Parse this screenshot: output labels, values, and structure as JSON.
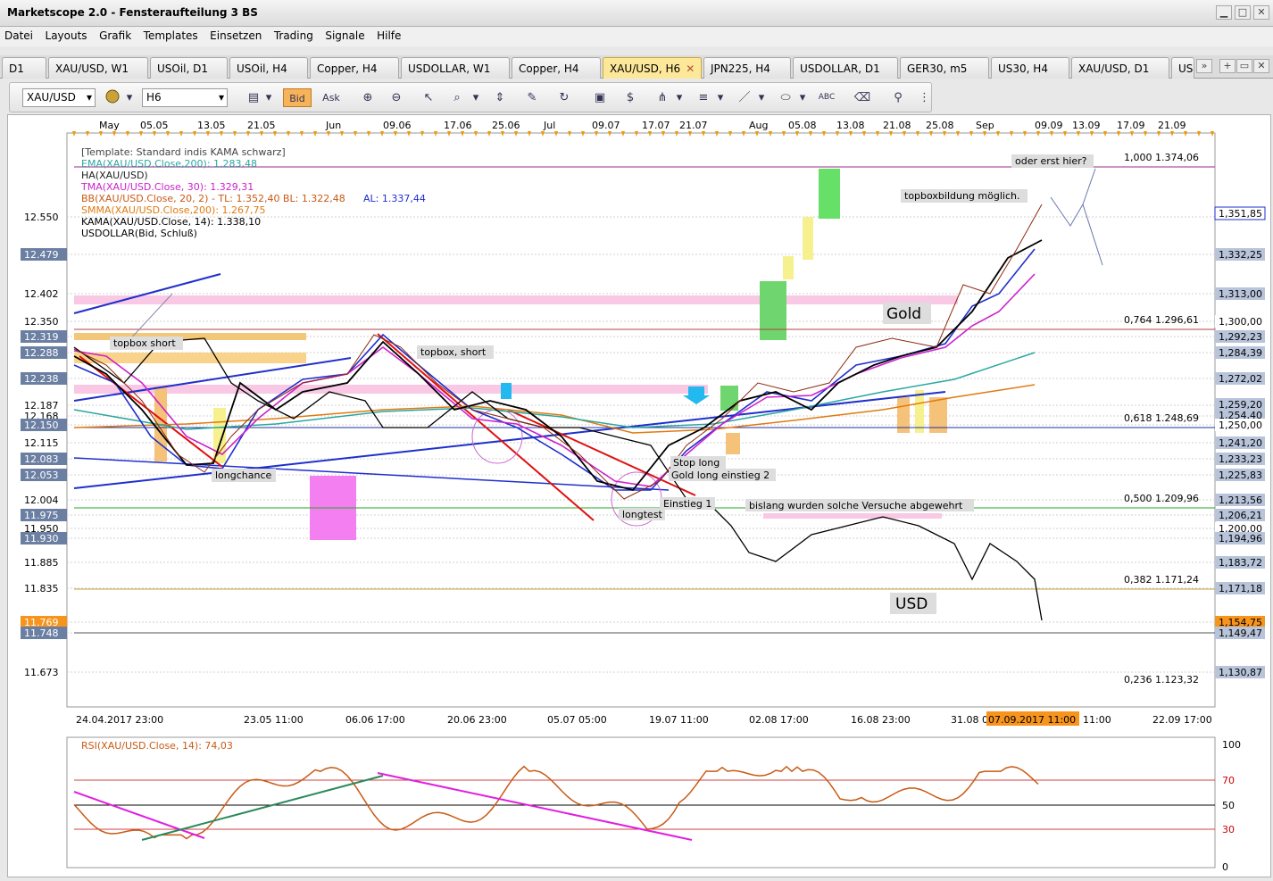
{
  "app": {
    "title": "Marketscope 2.0 - Fensteraufteilung 3 BS"
  },
  "menu": [
    "Datei",
    "Layouts",
    "Grafik",
    "Templates",
    "Einsetzen",
    "Trading",
    "Signale",
    "Hilfe"
  ],
  "tabs": [
    "D1",
    "XAU/USD, W1",
    "USOil, D1",
    "USOil, H4",
    "Copper, H4",
    "USDOLLAR, W1",
    "Copper, H4",
    "XAU/USD, H6",
    "JPN225, H4",
    "USDOLLAR, D1",
    "GER30, m5",
    "US30, H4",
    "XAU/USD, D1",
    "US"
  ],
  "active_tab_index": 7,
  "toolbar": {
    "symbol": "XAU/USD",
    "timeframe": "H6",
    "bid_label": "Bid",
    "ask_label": "Ask"
  },
  "time_axis_top": [
    "May",
    "05.05",
    "13.05",
    "21.05",
    "Jun",
    "09.06",
    "17.06",
    "25.06",
    "Jul",
    "09.07",
    "17.07",
    "21.07",
    "Aug",
    "05.08",
    "13.08",
    "21.08",
    "25.08",
    "Sep",
    "09.09",
    "13.09",
    "17.09",
    "21.09"
  ],
  "time_axis_bottom": [
    "24.04.2017 23:00",
    "23.05 11:00",
    "06.06 17:00",
    "20.06 23:00",
    "05.07 05:00",
    "19.07 11:00",
    "02.08 17:00",
    "16.08 23:00",
    "31.08 0",
    "07.09.2017 11:00",
    "11:00",
    "22.09 17:00"
  ],
  "left_axis": [
    "12.550",
    "12.479",
    "12.402",
    "12.350",
    "12.319",
    "12.288",
    "12.238",
    "12.187",
    "12.168",
    "12.150",
    "12.115",
    "12.083",
    "12.053",
    "12.004",
    "11.975",
    "11.950",
    "11.930",
    "11.885",
    "11.835",
    "11.769",
    "11.748",
    "11.673"
  ],
  "right_axis": [
    "1,351,85",
    "1,332,25",
    "1,313,00",
    "1,300,00",
    "1,292,23",
    "1,284,39",
    "1,272,02",
    "1,259,20",
    "1,254,40",
    "1,250,00",
    "1,241,20",
    "1,233,23",
    "1,225,83",
    "1,213,56",
    "1,206,21",
    "1,200,00",
    "1,194,96",
    "1,183,72",
    "1,171,18",
    "1,154,75",
    "1,149,47",
    "1,130,87"
  ],
  "fib_levels": [
    "1,000 1.374,06",
    "0,764 1.296,61",
    "0,618 1.248,69",
    "0,500 1.209,96",
    "0,382 1.171,24",
    "0,236 1.123,32"
  ],
  "legend": [
    {
      "text": "[Template: Standard indis KAMA schwarz]",
      "color": "#444444"
    },
    {
      "text": "EMA(XAU/USD.Close,200): 1.283,48",
      "color": "#2aa7a0"
    },
    {
      "text": "HA(XAU/USD)",
      "color": "#222222"
    },
    {
      "text": "TMA(XAU/USD.Close, 30): 1.329,31",
      "color": "#cc22cc"
    },
    {
      "text": "BB(XAU/USD.Close, 20, 2) -  TL: 1.352,40   BL: 1.322,48",
      "color": "#c85a14"
    },
    {
      "text": "AL: 1.337,44",
      "color": "#1f2fcc"
    },
    {
      "text": "SMMA(XAU/USD.Close,200): 1.267,75",
      "color": "#e07a10"
    },
    {
      "text": "KAMA(XAU/USD.Close, 14): 1.338,10",
      "color": "#000000"
    },
    {
      "text": "USDOLLAR(Bid, Schluß)",
      "color": "#000000"
    }
  ],
  "annotations": {
    "gold": "Gold",
    "usd": "USD",
    "oder": "oder erst hier?",
    "topbox_moeglich": "topboxbildung möglich.",
    "topbox_short": "topbox short",
    "topbox_short2": "topbox, short",
    "longchance": "longchance",
    "stop_long": "Stop long",
    "gold_long": "Gold long einstieg 2",
    "einstieg1": "Einstieg 1",
    "bislang": "bislang wurden solche Versuche abgewehrt",
    "longtest": "longtest"
  },
  "rsi": {
    "label": "RSI(XAU/USD.Close, 14): 74,03",
    "axis": [
      "100",
      "70",
      "50",
      "30",
      "0"
    ]
  },
  "colors": {
    "accent": "#fde89a",
    "price_badge": "#f7941d",
    "axis_badge": "#6b7fa3"
  }
}
